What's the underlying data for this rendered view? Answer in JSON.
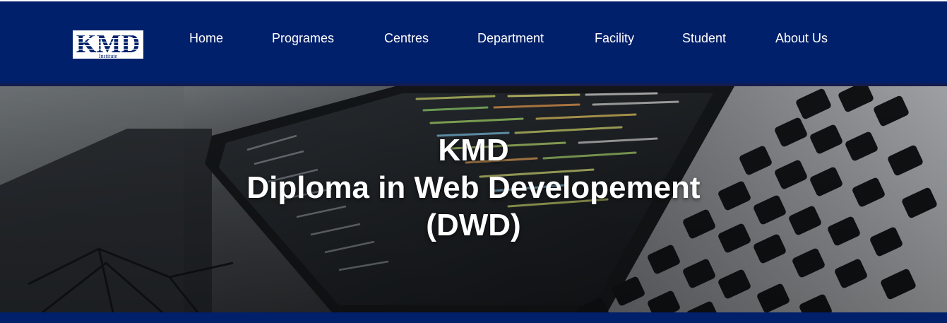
{
  "logo": {
    "text": "KMD",
    "subtext": "Institute"
  },
  "nav": {
    "items": [
      {
        "label": "Home"
      },
      {
        "label": "Programes"
      },
      {
        "label": "Centres"
      },
      {
        "label": "Department"
      },
      {
        "label": "Facility"
      },
      {
        "label": "Student"
      },
      {
        "label": "About Us"
      }
    ]
  },
  "hero": {
    "line1": "KMD",
    "line2": "Diploma in Web Developement",
    "line3": "(DWD)"
  },
  "colors": {
    "navbar": "#00206b",
    "hero_text": "#ffffff"
  }
}
